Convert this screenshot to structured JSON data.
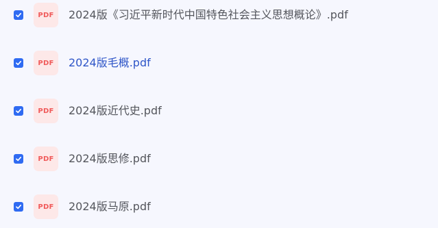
{
  "files": [
    {
      "name": "2024版《习近平新时代中国特色社会主义思想概论》.pdf",
      "checked": true,
      "icon": "PDF"
    },
    {
      "name": "2024版毛概.pdf",
      "checked": true,
      "icon": "PDF"
    },
    {
      "name": "2024版近代史.pdf",
      "checked": true,
      "icon": "PDF"
    },
    {
      "name": "2024版思修.pdf",
      "checked": true,
      "icon": "PDF"
    },
    {
      "name": "2024版马原.pdf",
      "checked": true,
      "icon": "PDF"
    }
  ],
  "colors": {
    "background": "#f6f7fe",
    "checkbox": "#2f6bf2",
    "pdf_icon_bg": "#fde8e8",
    "pdf_icon_text": "#f05a5a",
    "file_name": "#54565c",
    "file_name_hover": "#2f56c8"
  }
}
